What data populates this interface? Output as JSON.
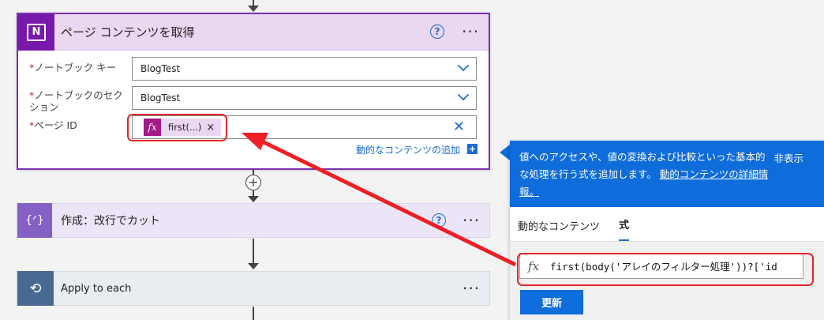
{
  "card1": {
    "title": "ページ コンテンツを取得",
    "logo_letter": "N",
    "help": "?",
    "more": "···",
    "fields": [
      {
        "required": "*",
        "label": "ノートブック キー",
        "value": "BlogTest"
      },
      {
        "required": "*",
        "label_line1": "ノートブックのセク",
        "label_line2": "ション",
        "value": "BlogTest"
      },
      {
        "required": "*",
        "label": "ページ ID",
        "token_icon": "fx",
        "token_text": "first(...)",
        "token_close": "×",
        "clear": "✕"
      }
    ],
    "dynamic_link": "動的なコンテンツの追加",
    "dynamic_plus": "+"
  },
  "add_step": "+",
  "card2": {
    "title": "作成：改行でカット",
    "logo": "{ᐟ}",
    "help": "?",
    "more": "···"
  },
  "card3": {
    "title": "Apply to each",
    "logo": "⟲",
    "more": "···"
  },
  "panel": {
    "banner_text": "値へのアクセスや、値の変換および比較といった基本的な処理を行う式を追加します。",
    "banner_link": "動的コンテンツの詳細情報。",
    "hide": "非表示",
    "tabs": [
      "動的なコンテンツ",
      "式"
    ],
    "active_tab": 1,
    "fx": "fx",
    "expression": "first(body('アレイのフィルター処理'))?['id",
    "update_button": "更新"
  },
  "colors": {
    "onenote": "#7719aa",
    "accent": "#0f6cdb",
    "highlight": "#e8232a"
  },
  "icons": [
    "onenote-icon",
    "help-icon",
    "more-icon",
    "chevron-down-icon",
    "close-icon",
    "fx-icon",
    "plus-icon",
    "compose-icon",
    "loop-icon"
  ]
}
